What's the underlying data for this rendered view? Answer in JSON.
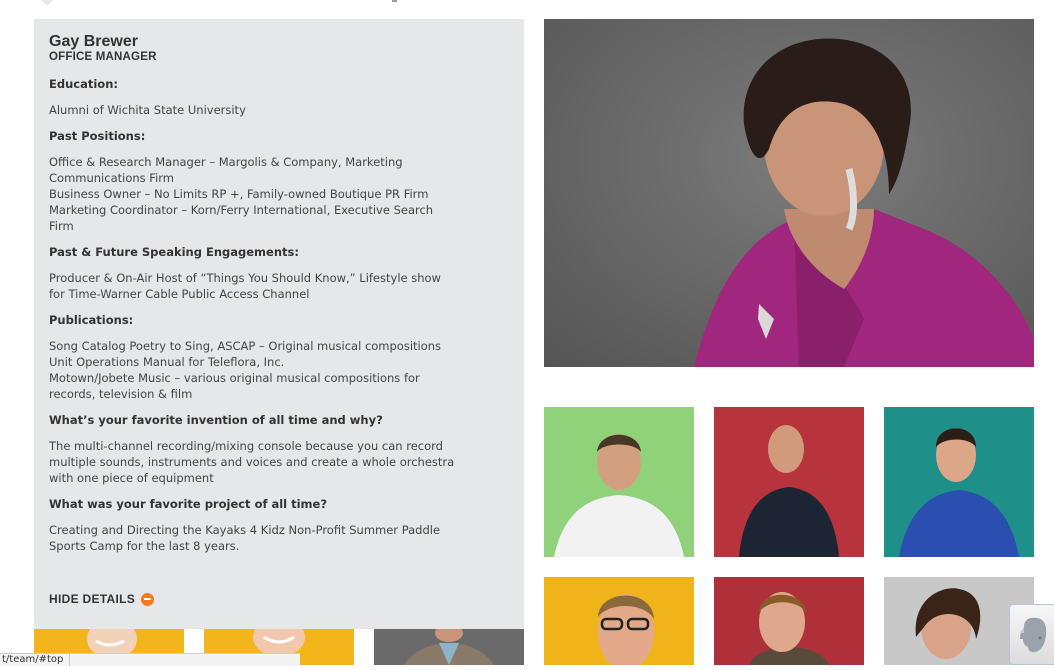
{
  "profile": {
    "name": "Gay Brewer",
    "title": "OFFICE MANAGER",
    "sections": [
      {
        "heading": "Education:",
        "lines": [
          "Alumni of Wichita State University"
        ]
      },
      {
        "heading": "Past Positions:",
        "lines": [
          "Office & Research Manager – Margolis & Company, Marketing Communications Firm",
          "Business Owner – No Limits RP +, Family-owned Boutique PR Firm",
          "Marketing Coordinator – Korn/Ferry International, Executive Search Firm"
        ]
      },
      {
        "heading": "Past & Future Speaking Engagements:",
        "lines": [
          "Producer & On-Air Host of “Things You Should Know,” Lifestyle show for Time-Warner Cable Public Access Channel"
        ]
      },
      {
        "heading": "Publications:",
        "lines": [
          "Song Catalog Poetry to Sing, ASCAP – Original musical compositions",
          "Unit Operations Manual for Teleflora, Inc.",
          "Motown/Jobete Music – various original musical compositions for records, television & film"
        ]
      },
      {
        "heading": "What’s your favorite invention of all time and why?",
        "lines": [
          "The multi-channel recording/mixing console because you can record multiple sounds, instruments and voices and create a whole orchestra with one piece of equipment"
        ]
      },
      {
        "heading": "What was your favorite project of all time?",
        "lines": [
          "Creating and Directing the Kayaks 4 Kidz Non-Profit Summer Paddle Sports Camp for the last 8 years."
        ]
      }
    ],
    "hide_label": "HIDE DETAILS",
    "hide_icon": "minus-circle-icon"
  },
  "team_tiles": [
    {
      "background": "#8fd27a",
      "shirt": "#f2f2f2"
    },
    {
      "background": "#b8343c",
      "shirt": "#1d2433"
    },
    {
      "background": "#1f8f8a",
      "shirt": "#2a4fb0"
    },
    {
      "background": "#f0b31a",
      "shirt": "#d9c9a0"
    },
    {
      "background": "#b0303a",
      "shirt": "#5a4a3a"
    },
    {
      "background": "#c8c8c8",
      "shirt": "#6b6b6b"
    },
    {
      "background": "#f2b61c",
      "shirt": "#ffffff"
    },
    {
      "background": "#f2b61c",
      "shirt": "#f6d0b0"
    },
    {
      "background": "#6a6a6a",
      "shirt": "#8fb4c8"
    }
  ],
  "colors": {
    "panel": "#e6e7e8",
    "accent": "#f47b20",
    "big_photo_bg": "#6a6a6a",
    "blouse": "#a0267e"
  },
  "status_url": "t/team/#top",
  "evernote_icon": "elephant-icon"
}
